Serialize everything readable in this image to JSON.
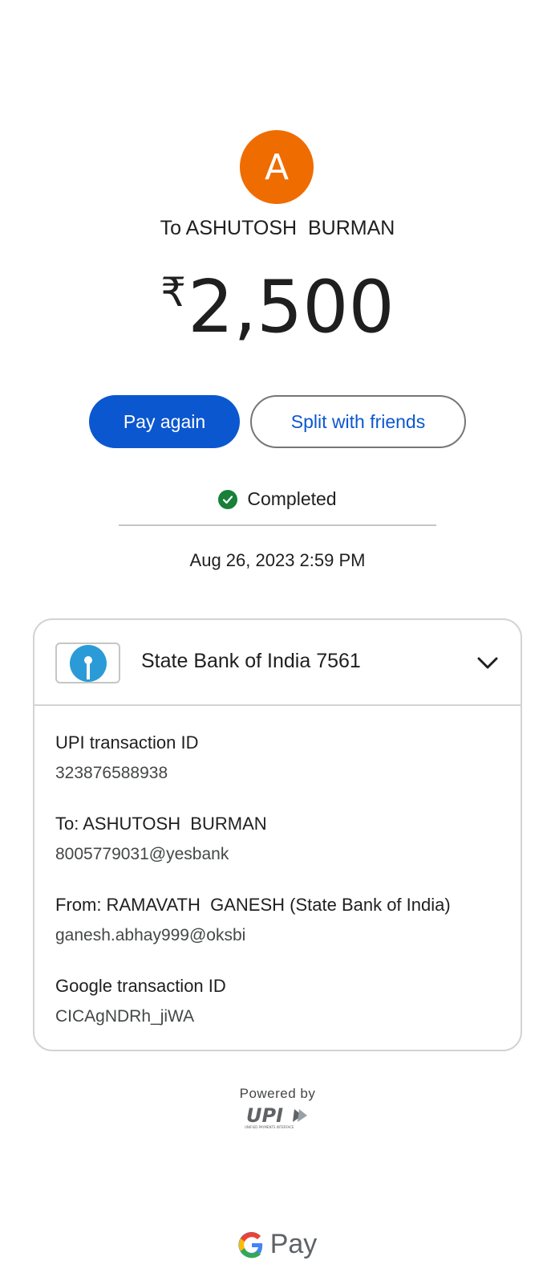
{
  "recipient": {
    "initial": "A",
    "label": "To ASHUTOSH  BURMAN",
    "avatar_color": "#ef6c00"
  },
  "amount": {
    "currency_symbol": "₹",
    "value": "2,500"
  },
  "actions": {
    "pay_again": "Pay again",
    "split": "Split with friends",
    "primary_color": "#0b57d0"
  },
  "status": {
    "text": "Completed",
    "icon": "check-circle-icon",
    "color": "#188038"
  },
  "datetime": "Aug 26, 2023 2:59 PM",
  "card": {
    "bank_name": "State Bank of India 7561",
    "bank_logo_icon": "sbi-logo-icon",
    "expand_icon": "chevron-down-icon",
    "details": [
      {
        "label": "UPI transaction ID",
        "value": "323876588938"
      },
      {
        "label": "To: ASHUTOSH  BURMAN",
        "value": "8005779031@yesbank"
      },
      {
        "label": "From: RAMAVATH  GANESH (State Bank of India)",
        "value": "ganesh.abhay999@oksbi"
      },
      {
        "label": "Google transaction ID",
        "value": "CICAgNDRh_jiWA"
      }
    ]
  },
  "footer": {
    "powered_by": "Powered by",
    "upi_logo": "UPI",
    "upi_tagline": "UNIFIED PAYMENTS INTERFACE",
    "gpay_text": "Pay",
    "gpay_icon": "google-g-icon"
  }
}
